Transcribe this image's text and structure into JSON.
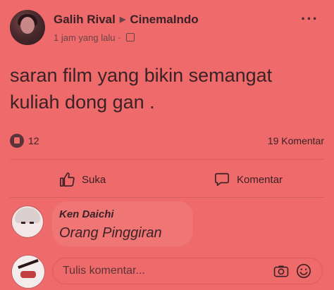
{
  "post": {
    "author": "Galih Rival",
    "group": "CinemaIndo",
    "time": "1 jam yang lalu",
    "text_line1": "saran film yang bikin semangat",
    "text_line2": "kuliah dong gan .",
    "likes": "12",
    "comments_count": "19 Komentar"
  },
  "actions": {
    "like_label": "Suka",
    "comment_label": "Komentar"
  },
  "comment": {
    "name": "Ken Daichi",
    "text": "Orang Pinggiran"
  },
  "input": {
    "placeholder": "Tulis komentar..."
  },
  "icons": {
    "more": "more-options-icon",
    "like": "thumbs-up-icon",
    "comment": "speech-bubble-icon",
    "camera": "camera-icon",
    "emoji": "emoji-icon",
    "privacy": "group-privacy-icon"
  },
  "colors": {
    "background": "#ef6a6a",
    "text": "#3a2226"
  }
}
